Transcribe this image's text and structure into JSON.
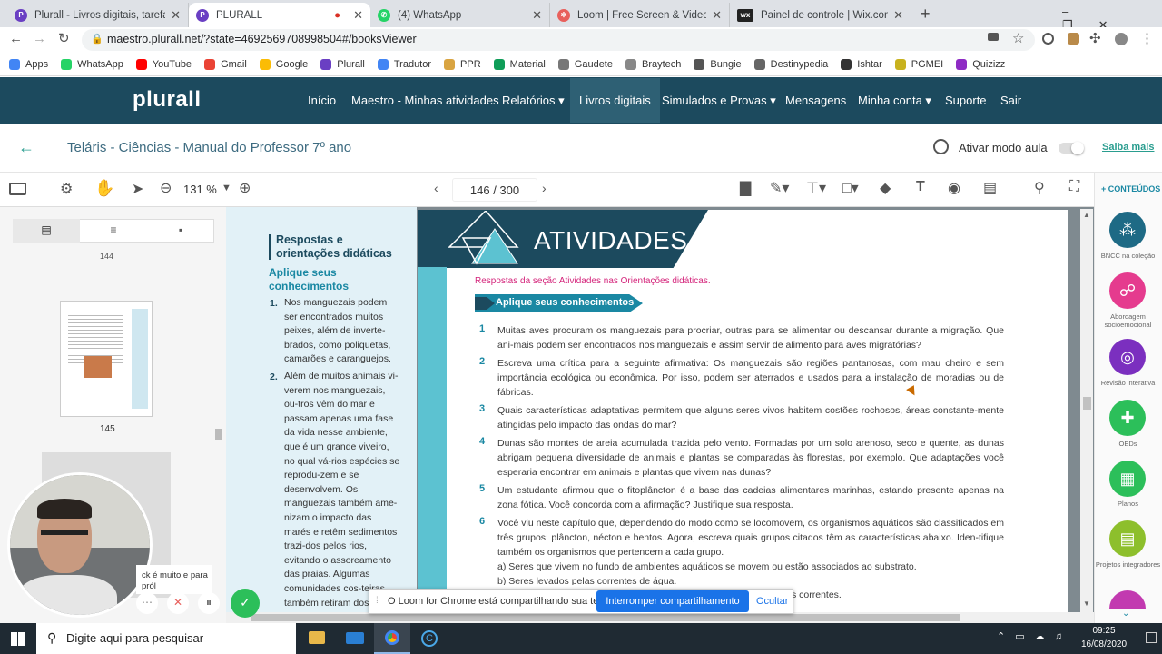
{
  "browser": {
    "tabs": [
      {
        "title": "Plurall - Livros digitais, tarefas, tu",
        "color": "#6a3fc3",
        "active": false
      },
      {
        "title": "PLURALL",
        "color": "#6a3fc3",
        "active": true
      },
      {
        "title": "(4) WhatsApp",
        "color": "#25d366",
        "active": false
      },
      {
        "title": "Loom | Free Screen & Video Reco",
        "color": "#e8605c",
        "active": false
      },
      {
        "title": "Painel de controle | Wix.com",
        "color": "#222222",
        "active": false
      }
    ],
    "url": "maestro.plurall.net/?state=4692569708998504#/booksViewer",
    "bookmarks": [
      {
        "label": "Apps",
        "color": "#4285f4"
      },
      {
        "label": "WhatsApp",
        "color": "#25d366"
      },
      {
        "label": "YouTube",
        "color": "#ff0000"
      },
      {
        "label": "Gmail",
        "color": "#ea4335"
      },
      {
        "label": "Google",
        "color": "#fbbc05"
      },
      {
        "label": "Plurall",
        "color": "#6a3fc3"
      },
      {
        "label": "Tradutor",
        "color": "#4285f4"
      },
      {
        "label": "PPR",
        "color": "#d9a441"
      },
      {
        "label": "Material",
        "color": "#0f9d58"
      },
      {
        "label": "Gaudete",
        "color": "#777777"
      },
      {
        "label": "Braytech",
        "color": "#888888"
      },
      {
        "label": "Bungie",
        "color": "#555555"
      },
      {
        "label": "Destinypedia",
        "color": "#666666"
      },
      {
        "label": "Ishtar",
        "color": "#333333"
      },
      {
        "label": "PGMEI",
        "color": "#c8b21e"
      },
      {
        "label": "Quizizz",
        "color": "#8e2bc4"
      }
    ]
  },
  "plurall": {
    "logo": "plurall",
    "nav": [
      {
        "label": "Início"
      },
      {
        "label": "Maestro - Minhas atividades"
      },
      {
        "label": "Relatórios ▾"
      },
      {
        "label": "Livros digitais"
      },
      {
        "label": "Simulados e Provas ▾"
      },
      {
        "label": "Mensagens"
      },
      {
        "label": "Minha conta ▾"
      },
      {
        "label": "Suporte"
      },
      {
        "label": "Sair"
      }
    ],
    "book_title": "Teláris - Ciências - Manual do Professor 7º ano",
    "class_mode_label": "Ativar modo aula",
    "learn_more": "Saiba mais"
  },
  "viewer": {
    "zoom": "131 %",
    "page_indicator": "146 / 300",
    "contents_label": "+ CONTEÚDOS",
    "thumbnails": {
      "prev_number": "144",
      "current_number": "145"
    }
  },
  "page_left": {
    "heading": "Respostas e orientações didáticas",
    "subheading": "Aplique seus conhecimentos",
    "items": [
      {
        "n": "1.",
        "text": "Nos manguezais podem ser encontrados muitos peixes, além de inverte-brados, como poliquetas, camarões e caranguejos."
      },
      {
        "n": "2.",
        "text": "Além de muitos animais vi-verem nos manguezais, ou-tros vêm do mar e passam apenas uma fase da vida nesse ambiente, que é um grande viveiro, no qual vá-rios espécies se reprodu-zem e se desenvolvem. Os manguezais também ame-nizam o impacto das marés e retêm sedimentos trazi-dos pelos rios, evitando o assoreamento das praias. Algumas comunidades cos-teiras também retiram dos manguezais seu ali... como ostras e caran..."
      }
    ]
  },
  "page_right": {
    "title": "ATIVIDADES",
    "note": "Respostas da seção Atividades nas Orientações didáticas.",
    "section": "Aplique seus conhecimentos",
    "questions": [
      {
        "n": "1",
        "text": "Muitas aves procuram os manguezais para procriar, outras para se alimentar ou descansar durante a migração. Que ani-mais podem ser encontrados nos manguezais e assim servir de alimento para aves migratórias?"
      },
      {
        "n": "2",
        "text": "Escreva uma crítica para a seguinte afirmativa: Os manguezais são regiões pantanosas, com mau cheiro e sem importância ecológica ou econômica. Por isso, podem ser aterrados e usados para a instalação de moradias ou de fábricas."
      },
      {
        "n": "3",
        "text": "Quais características adaptativas permitem que alguns seres vivos habitem costões rochosos, áreas constante-mente atingidas pelo impacto das ondas do mar?"
      },
      {
        "n": "4",
        "text": "Dunas são montes de areia acumulada trazida pelo vento. Formadas por um solo arenoso, seco e quente, as dunas abrigam pequena diversidade de animais e plantas se comparadas às florestas, por exemplo. Que adaptações você esperaria encontrar em animais e plantas que vivem nas dunas?"
      },
      {
        "n": "5",
        "text": "Um estudante afirmou que o fitoplâncton é a base das cadeias alimentares marinhas, estando presente apenas na zona fótica. Você concorda com a afirmação? Justifique sua resposta."
      },
      {
        "n": "6",
        "text": "Você viu neste capítulo que, dependendo do modo como se locomovem, os organismos aquáticos são classificados em três grupos: plâncton, nécton e bentos. Agora, escreva quais grupos citados têm as características abaixo. Iden-tifique também os organismos que pertencem a cada grupo."
      }
    ],
    "subitems": [
      "a) Seres que vivem no fundo de ambientes aquáticos se movem ou estão associados ao substrato.",
      "b) Seres levados pelas correntes de água."
    ],
    "trailing": "s correntes."
  },
  "sidebar_right": [
    {
      "label": "BNCC na coleção",
      "color": "#1e6a85"
    },
    {
      "label": "Abordagem socioemocional",
      "color": "#e53b8e"
    },
    {
      "label": "Revisão interativa",
      "color": "#7b2fbf"
    },
    {
      "label": "OEDs",
      "color": "#2cbf5a"
    },
    {
      "label": "Planos",
      "color": "#2cbf5a"
    },
    {
      "label": "Projetos integradores",
      "color": "#8dbf2c"
    }
  ],
  "loom": {
    "message": "O Loom for Chrome está compartilhando sua tela.",
    "stop_button": "Interromper compartilhamento",
    "hide_link": "Ocultar",
    "bubble_text": "ck é muito e para pról"
  },
  "taskbar": {
    "search_placeholder": "Digite aqui para pesquisar",
    "time": "09:25",
    "date": "16/08/2020"
  }
}
